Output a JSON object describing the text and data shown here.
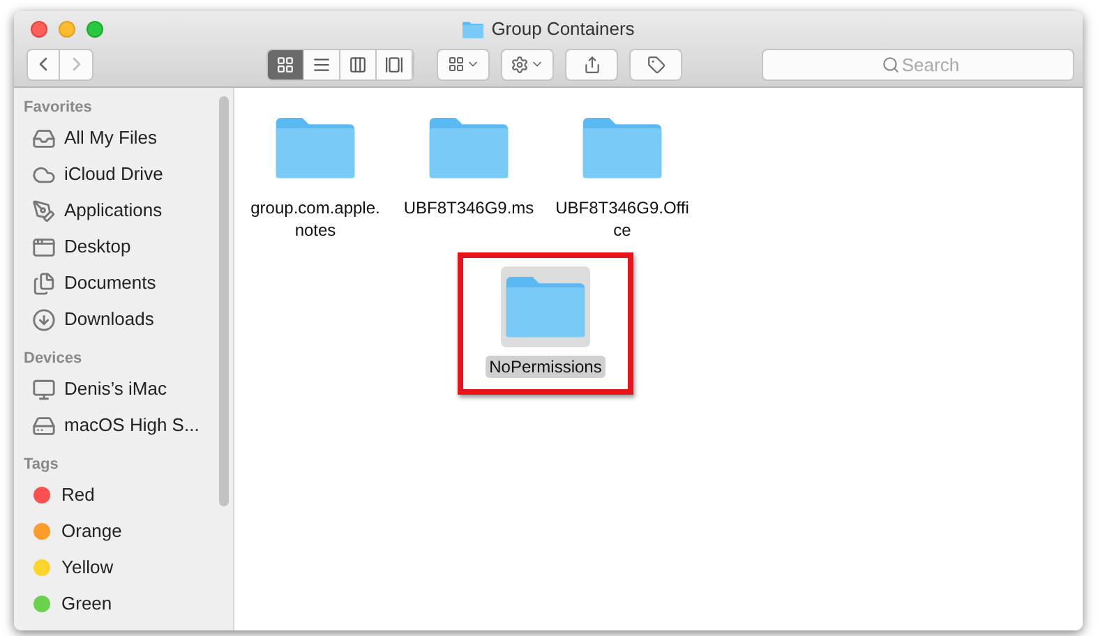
{
  "window": {
    "title": "Group Containers"
  },
  "toolbar": {
    "view_modes": [
      {
        "selected": true
      },
      {
        "selected": false
      },
      {
        "selected": false
      },
      {
        "selected": false
      }
    ],
    "search": {
      "placeholder": "Search"
    }
  },
  "sidebar": {
    "sections": [
      {
        "heading": "Favorites",
        "items": [
          {
            "label": "All My Files"
          },
          {
            "label": "iCloud Drive"
          },
          {
            "label": "Applications"
          },
          {
            "label": "Desktop"
          },
          {
            "label": "Documents"
          },
          {
            "label": "Downloads"
          }
        ]
      },
      {
        "heading": "Devices",
        "items": [
          {
            "label": "Denis’s iMac"
          },
          {
            "label": "macOS High S..."
          }
        ]
      },
      {
        "heading": "Tags",
        "items": [
          {
            "label": "Red",
            "color": "#fc4f4f"
          },
          {
            "label": "Orange",
            "color": "#fd9c2b"
          },
          {
            "label": "Yellow",
            "color": "#fdd42b"
          },
          {
            "label": "Green",
            "color": "#69d14b"
          }
        ]
      }
    ]
  },
  "files": [
    {
      "name": "group.com.apple.\nnotes",
      "selected": false
    },
    {
      "name": "UBF8T346G9.ms",
      "selected": false
    },
    {
      "name": "UBF8T346G9.Offi\nce",
      "selected": false
    },
    {
      "name": "NoPermissions",
      "selected": true
    }
  ]
}
